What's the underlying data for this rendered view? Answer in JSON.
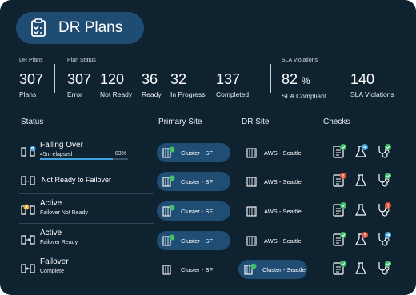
{
  "header": {
    "title": "DR Plans"
  },
  "stats": {
    "dr_plans_label": "DR Plans",
    "plan_status_label": "Plan Status",
    "sla_label": "SLA Violations",
    "items": [
      {
        "value": "307",
        "label": "Plans"
      },
      {
        "value": "307",
        "label": "Error"
      },
      {
        "value": "120",
        "label": "Not Ready"
      },
      {
        "value": "36",
        "label": "Ready"
      },
      {
        "value": "32",
        "label": "In Progress"
      },
      {
        "value": "137",
        "label": "Completed"
      },
      {
        "value": "82",
        "unit": "%",
        "label": "SLA Compliant"
      },
      {
        "value": "140",
        "label": "SLA Violations"
      }
    ]
  },
  "columns": {
    "status": "Status",
    "primary": "Primary Site",
    "dr": "DR Site",
    "checks": "Checks"
  },
  "rows": [
    {
      "title": "Failing Over",
      "sub": "45m elapsed",
      "progress_pct": 83,
      "progress_text": "83%",
      "primary": "Cluster - SF",
      "dr": "AWS - Seattle"
    },
    {
      "title": "Not Ready to Failover",
      "sub": "",
      "primary": "Cluster - SF",
      "dr": "AWS - Seattle"
    },
    {
      "title": "Active",
      "sub": "Failover Not Ready",
      "primary": "Cluster - SF",
      "dr": "AWS - Seattle"
    },
    {
      "title": "Active",
      "sub": "Failover Ready",
      "primary": "Cluster - SF",
      "dr": "AWS - Seattle"
    },
    {
      "title": "Failover",
      "sub": "Complete",
      "primary": "Cluster - SF",
      "dr": "Cluster - Seattle"
    }
  ],
  "colors": {
    "panel": "#0f2230",
    "pill": "#1e4c73",
    "ok": "#3fc06b",
    "error": "#e0553d",
    "info": "#3ea2e0",
    "warn": "#f0a030"
  }
}
